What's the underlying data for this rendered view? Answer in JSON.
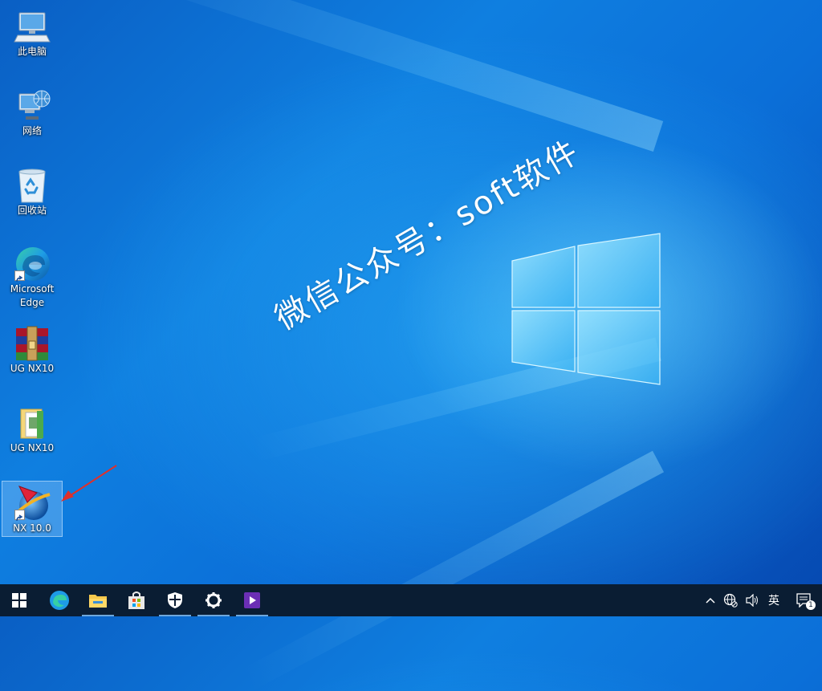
{
  "desktop": {
    "icons": [
      {
        "label": "此电脑",
        "icon": "this-pc-icon"
      },
      {
        "label": "网络",
        "icon": "network-icon"
      },
      {
        "label": "回收站",
        "icon": "recycle-bin-icon"
      },
      {
        "label": "Microsoft Edge",
        "icon": "edge-icon"
      },
      {
        "label": "UG NX10",
        "icon": "winrar-archive-icon"
      },
      {
        "label": "UG NX10",
        "icon": "folder-icon"
      },
      {
        "label": "NX 10.0",
        "icon": "nx-app-icon",
        "selected": true
      }
    ],
    "watermark": "微信公众号：soft软件"
  },
  "taskbar": {
    "items": [
      "start-icon",
      "edge-icon",
      "file-explorer-icon",
      "store-icon",
      "security-icon",
      "settings-icon",
      "media-player-icon"
    ],
    "tray": {
      "chevron": "^",
      "ime_label": "英",
      "notification_count": "1"
    }
  },
  "colors": {
    "taskbar": "#0a1d33",
    "wallpaper_accent": "#0f7fe0",
    "arrow": "#e0302a"
  }
}
